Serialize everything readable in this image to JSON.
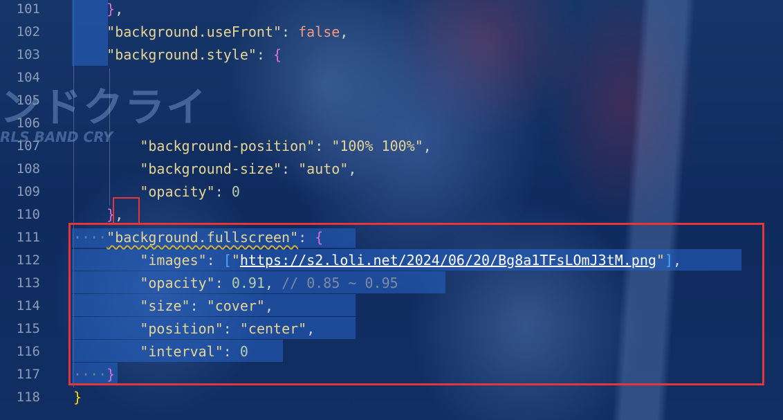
{
  "editor": {
    "lines": [
      {
        "num": "101",
        "indent": "    ",
        "tokens": [
          {
            "t": "}",
            "c": "brace2"
          },
          {
            "t": ",",
            "c": "p"
          }
        ]
      },
      {
        "num": "102",
        "indent": "    ",
        "tokens": [
          {
            "t": "\"background.useFront\"",
            "c": "k"
          },
          {
            "t": ": ",
            "c": "p"
          },
          {
            "t": "false",
            "c": "kw"
          },
          {
            "t": ",",
            "c": "p"
          }
        ]
      },
      {
        "num": "103",
        "indent": "    ",
        "tokens": [
          {
            "t": "\"background.style\"",
            "c": "k"
          },
          {
            "t": ": ",
            "c": "p"
          },
          {
            "t": "{",
            "c": "brace2"
          }
        ]
      },
      {
        "num": "104",
        "indent": "",
        "tokens": []
      },
      {
        "num": "105",
        "indent": "",
        "tokens": []
      },
      {
        "num": "106",
        "indent": "",
        "tokens": []
      },
      {
        "num": "107",
        "indent": "        ",
        "tokens": [
          {
            "t": "\"background-position\"",
            "c": "k"
          },
          {
            "t": ": ",
            "c": "p"
          },
          {
            "t": "\"100% 100%\"",
            "c": "s"
          },
          {
            "t": ",",
            "c": "p"
          }
        ]
      },
      {
        "num": "108",
        "indent": "        ",
        "tokens": [
          {
            "t": "\"background-size\"",
            "c": "k"
          },
          {
            "t": ": ",
            "c": "p"
          },
          {
            "t": "\"auto\"",
            "c": "s"
          },
          {
            "t": ",",
            "c": "p"
          }
        ]
      },
      {
        "num": "109",
        "indent": "        ",
        "tokens": [
          {
            "t": "\"opacity\"",
            "c": "k"
          },
          {
            "t": ": ",
            "c": "p"
          },
          {
            "t": "0",
            "c": "n"
          }
        ]
      },
      {
        "num": "110",
        "indent": "    ",
        "tokens": [
          {
            "t": "}",
            "c": "brace2"
          },
          {
            "t": ",",
            "c": "p"
          }
        ]
      },
      {
        "num": "111",
        "indent": "····",
        "tokens": [
          {
            "t": "\"background.fullscreen\"",
            "c": "k warn"
          },
          {
            "t": ": ",
            "c": "p"
          },
          {
            "t": "{",
            "c": "brace2"
          }
        ]
      },
      {
        "num": "112",
        "indent": "        ",
        "tokens": [
          {
            "t": "\"images\"",
            "c": "k"
          },
          {
            "t": ": ",
            "c": "p"
          },
          {
            "t": "[",
            "c": "brace3"
          },
          {
            "t": "\"",
            "c": "s"
          },
          {
            "t": "https://s2.loli.net/2024/06/20/Bg8a1TFsLOmJ3tM.png",
            "c": "url"
          },
          {
            "t": "\"",
            "c": "s"
          },
          {
            "t": "]",
            "c": "brace3"
          },
          {
            "t": ",",
            "c": "p"
          }
        ]
      },
      {
        "num": "113",
        "indent": "        ",
        "tokens": [
          {
            "t": "\"opacity\"",
            "c": "k"
          },
          {
            "t": ": ",
            "c": "p"
          },
          {
            "t": "0.91",
            "c": "n"
          },
          {
            "t": ", ",
            "c": "p"
          },
          {
            "t": "// 0.85 ~ 0.95",
            "c": "cm"
          }
        ]
      },
      {
        "num": "114",
        "indent": "        ",
        "tokens": [
          {
            "t": "\"size\"",
            "c": "k"
          },
          {
            "t": ": ",
            "c": "p"
          },
          {
            "t": "\"cover\"",
            "c": "s"
          },
          {
            "t": ",",
            "c": "p"
          }
        ]
      },
      {
        "num": "115",
        "indent": "        ",
        "tokens": [
          {
            "t": "\"position\"",
            "c": "k"
          },
          {
            "t": ": ",
            "c": "p"
          },
          {
            "t": "\"center\"",
            "c": "s"
          },
          {
            "t": ",",
            "c": "p"
          }
        ]
      },
      {
        "num": "116",
        "indent": "        ",
        "tokens": [
          {
            "t": "\"interval\"",
            "c": "k"
          },
          {
            "t": ": ",
            "c": "p"
          },
          {
            "t": "0",
            "c": "n"
          }
        ]
      },
      {
        "num": "117",
        "indent": "····",
        "tokens": [
          {
            "t": "}",
            "c": "brace2"
          }
        ]
      },
      {
        "num": "118",
        "indent": "",
        "tokens": [
          {
            "t": "}",
            "c": "brace1"
          }
        ]
      }
    ]
  },
  "background": {
    "logo_text": "ンドクライ",
    "logo_sub": "RLS BAND CRY"
  },
  "colors": {
    "highlight_border": "#e5363a",
    "selection": "#2864c8"
  }
}
